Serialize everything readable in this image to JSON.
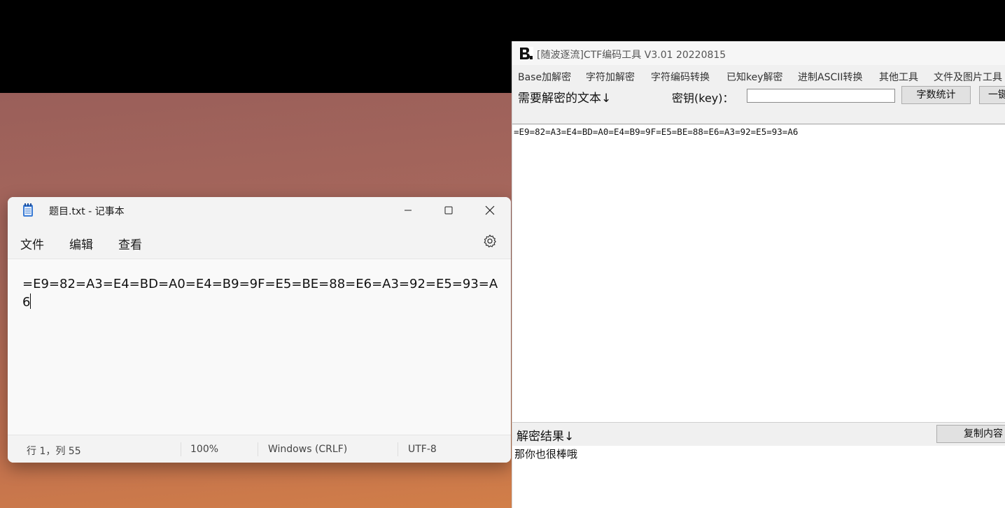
{
  "notepad": {
    "title": "题目.txt - 记事本",
    "menu": {
      "file": "文件",
      "edit": "编辑",
      "view": "查看"
    },
    "content": "=E9=82=A3=E4=BD=A0=E4=B9=9F=E5=BE=88=E6=A3=92=E5=93=A6",
    "status": {
      "position": "行 1，列 55",
      "zoom": "100%",
      "line_ending": "Windows (CRLF)",
      "encoding": "UTF-8"
    },
    "icons": [
      "notepad-icon",
      "minimize-icon",
      "maximize-icon",
      "close-icon",
      "gear-icon"
    ]
  },
  "ctf_tool": {
    "title": "[随波逐流]CTF编码工具 V3.01    20220815",
    "menus": [
      "Base加解密",
      "字符加解密",
      "字符编码转换",
      "已知key解密",
      "进制ASCII转换",
      "其他工具",
      "文件及图片工具"
    ],
    "input_label": "需要解密的文本↓",
    "key_label": "密钥(key)：",
    "key_value": "",
    "count_button": "字数统计",
    "onekey_button": "一键",
    "input_text": "=E9=82=A3=E4=BD=A0=E4=B9=9F=E5=BE=88=E6=A3=92=E5=93=A6",
    "result_label": "解密结果↓",
    "copy_button": "复制内容",
    "result_text": "那你也很棒哦"
  }
}
